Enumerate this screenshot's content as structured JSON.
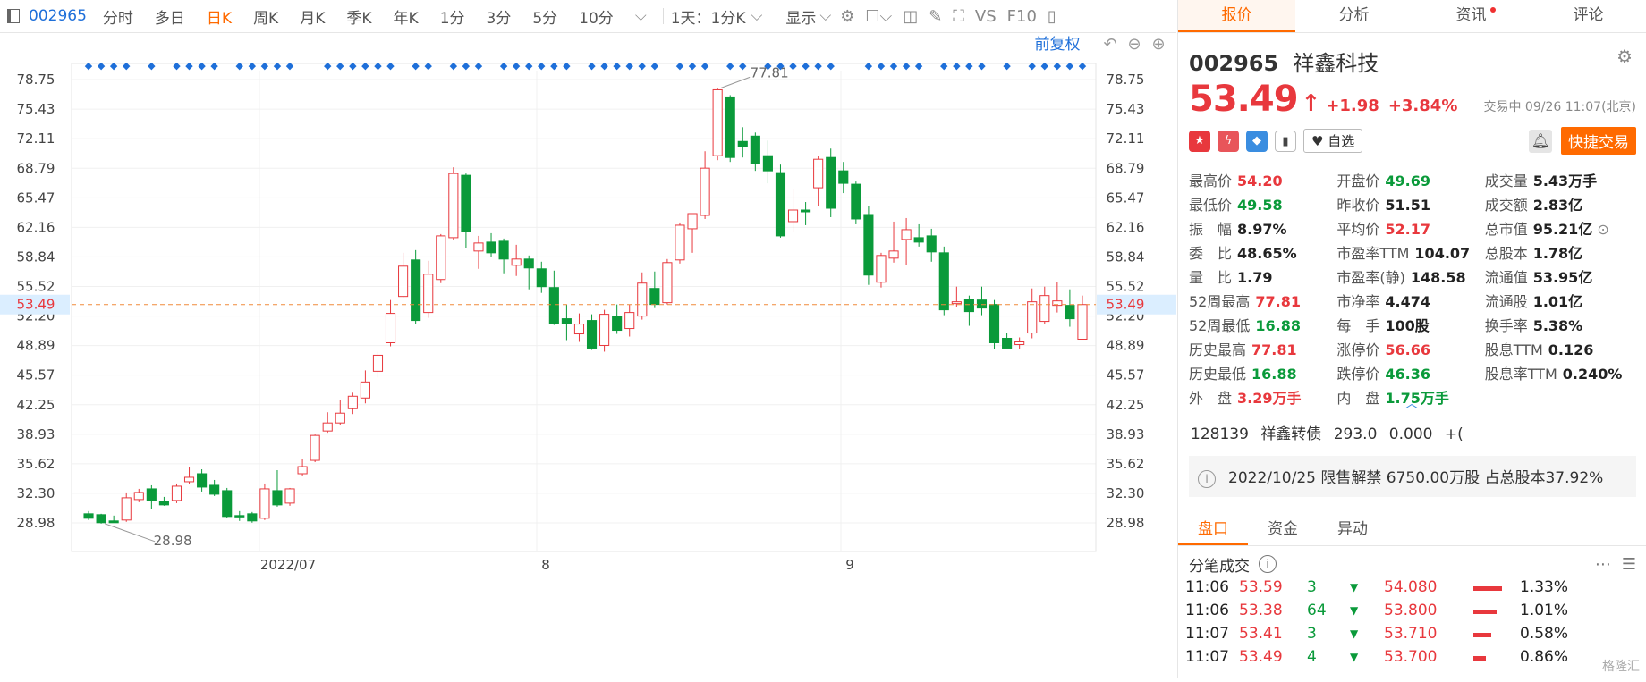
{
  "toolbar": {
    "code": "002965",
    "periods": [
      "分时",
      "多日",
      "日K",
      "周K",
      "月K",
      "季K",
      "年K",
      "1分",
      "3分",
      "5分",
      "10分"
    ],
    "active_period": "日K",
    "combo": "1天：1分K",
    "display": "显示",
    "vs": "VS",
    "f10": "F10"
  },
  "chart_data": {
    "type": "candlestick",
    "restore_label": "前复权",
    "y_ticks": [
      "78.75",
      "75.43",
      "72.11",
      "68.79",
      "65.47",
      "62.16",
      "58.84",
      "55.52",
      "52.20",
      "48.89",
      "45.57",
      "42.25",
      "38.93",
      "35.62",
      "32.30",
      "28.98"
    ],
    "ylim": [
      28.98,
      78.75
    ],
    "x_labels": [
      "2022/07",
      "8",
      "9"
    ],
    "current_price_label": "53.49",
    "current_price": 53.49,
    "high_label": "77.81",
    "low_label": "28.98",
    "candles": [
      [
        30.0,
        30.3,
        29.5,
        29.3
      ],
      [
        29.9,
        30.0,
        29.0,
        28.9
      ],
      [
        29.2,
        29.8,
        29.0,
        28.98
      ],
      [
        29.3,
        32.4,
        31.8,
        29.1
      ],
      [
        31.6,
        32.8,
        32.4,
        31.3
      ],
      [
        32.8,
        33.2,
        31.5,
        30.5
      ],
      [
        31.4,
        31.9,
        31.0,
        30.9
      ],
      [
        31.5,
        33.4,
        33.1,
        31.2
      ],
      [
        33.6,
        35.2,
        34.1,
        33.4
      ],
      [
        34.5,
        35.0,
        33.0,
        32.5
      ],
      [
        33.2,
        33.8,
        32.2,
        32.0
      ],
      [
        32.6,
        32.9,
        29.7,
        29.5
      ],
      [
        29.8,
        30.3,
        29.7,
        29.2
      ],
      [
        30.0,
        30.2,
        29.2,
        29.0
      ],
      [
        29.5,
        33.4,
        32.8,
        29.3
      ],
      [
        32.6,
        34.9,
        31.0,
        30.8
      ],
      [
        31.2,
        32.9,
        32.8,
        30.9
      ],
      [
        34.5,
        36.2,
        35.3,
        34.3
      ],
      [
        36.0,
        38.9,
        38.8,
        35.8
      ],
      [
        39.3,
        41.4,
        40.2,
        39.1
      ],
      [
        40.2,
        42.8,
        41.3,
        40.0
      ],
      [
        41.8,
        43.6,
        43.2,
        41.2
      ],
      [
        43.0,
        46.1,
        44.8,
        42.4
      ],
      [
        46.0,
        48.2,
        47.8,
        45.3
      ],
      [
        49.2,
        54.0,
        52.5,
        48.8
      ],
      [
        54.4,
        59.3,
        57.8,
        54.3
      ],
      [
        58.5,
        59.6,
        51.7,
        51.3
      ],
      [
        52.6,
        58.4,
        56.9,
        52.0
      ],
      [
        56.3,
        61.4,
        61.2,
        55.9
      ],
      [
        61.0,
        68.9,
        68.2,
        60.7
      ],
      [
        68.0,
        68.2,
        61.7,
        59.8
      ],
      [
        59.5,
        61.2,
        60.4,
        57.5
      ],
      [
        60.5,
        61.5,
        59.3,
        58.8
      ],
      [
        60.6,
        60.9,
        58.6,
        57.0
      ],
      [
        57.9,
        60.2,
        58.6,
        56.7
      ],
      [
        58.6,
        59.0,
        57.6,
        55.2
      ],
      [
        57.5,
        58.3,
        55.5,
        54.8
      ],
      [
        55.4,
        57.3,
        51.4,
        51.2
      ],
      [
        51.9,
        53.5,
        51.4,
        49.5
      ],
      [
        50.2,
        52.5,
        51.3,
        49.3
      ],
      [
        51.7,
        52.4,
        48.6,
        48.4
      ],
      [
        48.9,
        52.9,
        52.4,
        48.2
      ],
      [
        52.2,
        53.5,
        50.6,
        50.2
      ],
      [
        50.8,
        53.5,
        52.6,
        49.9
      ],
      [
        52.2,
        57.1,
        55.9,
        51.8
      ],
      [
        55.3,
        57.2,
        53.5,
        53.1
      ],
      [
        53.7,
        58.6,
        58.2,
        53.5
      ],
      [
        58.5,
        62.7,
        62.4,
        58.1
      ],
      [
        62.0,
        63.2,
        63.7,
        59.3
      ],
      [
        63.5,
        70.7,
        68.8,
        63.1
      ],
      [
        70.2,
        77.81,
        77.6,
        69.7
      ],
      [
        76.8,
        77.0,
        70.0,
        69.5
      ],
      [
        71.8,
        73.4,
        71.2,
        70.0
      ],
      [
        72.4,
        72.8,
        69.3,
        68.5
      ],
      [
        70.2,
        71.9,
        68.5,
        67.1
      ],
      [
        68.3,
        69.2,
        61.2,
        61.0
      ],
      [
        62.8,
        66.5,
        64.1,
        61.6
      ],
      [
        64.1,
        65.0,
        63.9,
        62.4
      ],
      [
        66.6,
        70.2,
        69.8,
        64.6
      ],
      [
        70.0,
        71.0,
        64.3,
        63.3
      ],
      [
        68.5,
        69.5,
        67.1,
        66.0
      ],
      [
        67.0,
        67.3,
        63.1,
        62.5
      ],
      [
        63.6,
        64.6,
        56.8,
        55.7
      ],
      [
        56.0,
        59.3,
        59.0,
        55.4
      ],
      [
        58.7,
        62.8,
        59.5,
        58.2
      ],
      [
        60.8,
        63.2,
        61.9,
        57.9
      ],
      [
        61.0,
        62.5,
        60.5,
        60.0
      ],
      [
        61.2,
        62.0,
        59.4,
        58.3
      ],
      [
        59.3,
        60.0,
        52.9,
        52.3
      ],
      [
        53.6,
        55.5,
        53.8,
        53.2
      ],
      [
        54.1,
        54.5,
        52.7,
        51.1
      ],
      [
        54.0,
        55.5,
        53.1,
        52.3
      ],
      [
        53.5,
        54.0,
        49.2,
        48.5
      ],
      [
        49.7,
        50.3,
        48.6,
        48.6
      ],
      [
        49.0,
        49.8,
        49.3,
        48.5
      ],
      [
        50.3,
        55.3,
        53.8,
        49.7
      ],
      [
        51.6,
        55.5,
        54.5,
        51.3
      ],
      [
        53.4,
        56.0,
        53.9,
        52.6
      ],
      [
        53.4,
        55.2,
        51.9,
        51.0
      ],
      [
        49.6,
        54.5,
        53.49,
        49.6
      ]
    ]
  },
  "tabs": [
    "报价",
    "分析",
    "资讯",
    "评论"
  ],
  "active_tab": "报价",
  "stock": {
    "code": "002965",
    "name": "祥鑫科技",
    "price": "53.49",
    "change": "+1.98",
    "pct": "+3.84%",
    "status": "交易中 09/26 11:07(北京)"
  },
  "watch_label": "自选",
  "trade_label": "快捷交易",
  "quote_grid": [
    [
      [
        "最高价",
        "54.20",
        "red"
      ],
      [
        "开盘价",
        "49.69",
        "green"
      ],
      [
        "成交量",
        "5.43万手",
        "dark"
      ]
    ],
    [
      [
        "最低价",
        "49.58",
        "green"
      ],
      [
        "昨收价",
        "51.51",
        "dark"
      ],
      [
        "成交额",
        "2.83亿",
        "dark"
      ]
    ],
    [
      [
        "振　幅",
        "8.97%",
        "dark"
      ],
      [
        "平均价",
        "52.17",
        "red"
      ],
      [
        "总市值",
        "95.21亿",
        "dark"
      ]
    ],
    [
      [
        "委　比",
        "48.65%",
        "dark"
      ],
      [
        "市盈率TTM",
        "104.07",
        "dark"
      ],
      [
        "总股本",
        "1.78亿",
        "dark"
      ]
    ],
    [
      [
        "量　比",
        "1.79",
        "dark"
      ],
      [
        "市盈率(静)",
        "148.58",
        "dark"
      ],
      [
        "流通值",
        "53.95亿",
        "dark"
      ]
    ],
    [
      [
        "52周最高",
        "77.81",
        "red"
      ],
      [
        "市净率",
        "4.474",
        "dark"
      ],
      [
        "流通股",
        "1.01亿",
        "dark"
      ]
    ],
    [
      [
        "52周最低",
        "16.88",
        "green"
      ],
      [
        "每　手",
        "100股",
        "dark"
      ],
      [
        "换手率",
        "5.38%",
        "dark"
      ]
    ],
    [
      [
        "历史最高",
        "77.81",
        "red"
      ],
      [
        "涨停价",
        "56.66",
        "red"
      ],
      [
        "股息TTM",
        "0.126",
        "dark"
      ]
    ],
    [
      [
        "历史最低",
        "16.88",
        "green"
      ],
      [
        "跌停价",
        "46.36",
        "green"
      ],
      [
        "股息率TTM",
        "0.240%",
        "dark"
      ]
    ],
    [
      [
        "外　盘",
        "3.29万手",
        "red"
      ],
      [
        "内　盘",
        "1.75万手",
        "green"
      ],
      null
    ]
  ],
  "bond": {
    "code": "128139",
    "name": "祥鑫转债",
    "price": "293.0",
    "change": "0.000",
    "pct": "+("
  },
  "notice": "2022/10/25  限售解禁 6750.00万股 占总股本37.92%",
  "sub_tabs": [
    "盘口",
    "资金",
    "异动"
  ],
  "ticks_title": "分笔成交",
  "ticks": [
    {
      "time": "11:06",
      "price": "53.59",
      "vol": "3",
      "level": "54.080",
      "pct": "1.33%"
    },
    {
      "time": "11:06",
      "price": "53.38",
      "vol": "64",
      "level": "53.800",
      "pct": "1.01%"
    },
    {
      "time": "11:07",
      "price": "53.41",
      "vol": "3",
      "level": "53.710",
      "pct": "0.58%"
    },
    {
      "time": "11:07",
      "price": "53.49",
      "vol": "4",
      "level": "53.700",
      "pct": "0.86%"
    }
  ],
  "watermark": "格隆汇"
}
